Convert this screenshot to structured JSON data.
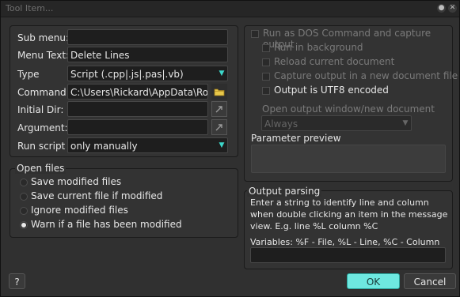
{
  "window": {
    "title": "Tool Item..."
  },
  "left": {
    "submenu": {
      "label": "Sub menu:",
      "value": ""
    },
    "menu_text": {
      "label": "Menu Text:",
      "value": "Delete Lines"
    },
    "type": {
      "label": "Type",
      "value": "Script (.cpp|.js|.pas|.vb)"
    },
    "command": {
      "label": "Command:",
      "value": "C:\\Users\\Rickard\\AppData\\Roaming"
    },
    "initial_dir": {
      "label": "Initial Dir:",
      "value": ""
    },
    "argument": {
      "label": "Argument:",
      "value": ""
    },
    "run_script": {
      "label": "Run script",
      "value": "only manually"
    }
  },
  "open_files": {
    "title": "Open files",
    "options": [
      {
        "label": "Save modified files",
        "selected": false
      },
      {
        "label": "Save current file if modified",
        "selected": false
      },
      {
        "label": "Ignore modified files",
        "selected": false
      },
      {
        "label": "Warn if a file has been modified",
        "selected": true
      }
    ]
  },
  "right": {
    "run_dos": "Run as DOS Command and capture output",
    "run_background": "Run in background",
    "reload_doc": "Reload current document",
    "capture_new_doc": "Capture output in a new document file",
    "utf8": "Output is UTF8 encoded",
    "open_output_label": "Open output window/new document",
    "open_output_value": "Always",
    "param_preview_label": "Parameter preview"
  },
  "output_parsing": {
    "title": "Output parsing",
    "description": "Enter a string to identify line and column when double clicking an item in the message view. E.g. line %L column %C",
    "variables": "Variables: %F - File, %L - Line, %C - Column",
    "value": ""
  },
  "buttons": {
    "help": "?",
    "ok": "OK",
    "cancel": "Cancel"
  },
  "colors": {
    "accent": "#6ee8e0",
    "background": "#303030"
  },
  "icons": {
    "folder": "folder-icon"
  }
}
